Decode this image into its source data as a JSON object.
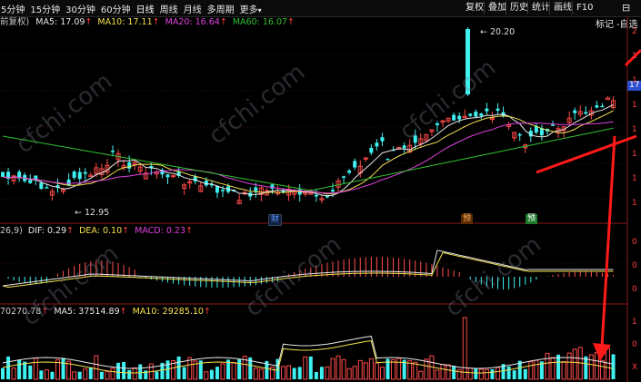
{
  "toolbar": {
    "periods": [
      "5分钟",
      "15分钟",
      "30分钟",
      "60分钟",
      "日线",
      "周线",
      "月线",
      "多周期",
      "更多"
    ],
    "tools": [
      "复权",
      "叠加",
      "历史",
      "统计",
      "画线",
      "F10",
      "标记",
      "-自选"
    ],
    "more_arrow": "▾",
    "top_right_icon": "⊟"
  },
  "main_indicator": {
    "prefix": "前复权)",
    "ma5": "MA5: 17.09",
    "ma10": "MA10: 17.11",
    "ma20": "MA20: 16.64",
    "ma60": "MA60: 16.07",
    "high_label": "20.20",
    "low_label": "12.95",
    "right_tag": "17",
    "colors": {
      "ma5": "#e8e8e8",
      "ma10": "#f5e050",
      "ma20": "#e040e0",
      "ma60": "#30c030",
      "up": "#ff4a4a",
      "down": "#3ff0f0"
    }
  },
  "event_tags": [
    "财",
    "预",
    "预"
  ],
  "macd_indicator": {
    "params": "26,9)",
    "dif": "DIF: 0.29",
    "dea": "DEA: 0.10",
    "macd": "MACD: 0.23"
  },
  "volume_indicator": {
    "prefix": "70270.78",
    "ma5": "MA5: 37514.89",
    "ma10": "MA10: 29285.10"
  },
  "up_arrow": "↑",
  "watermark": "cfchi.com",
  "right_axis": {
    "main": [
      "2",
      "1",
      "1",
      "1",
      "1",
      "1",
      "1",
      "1"
    ],
    "macd": [
      "0",
      "0",
      "0"
    ],
    "vol": [
      "1",
      "0",
      "X"
    ]
  }
}
